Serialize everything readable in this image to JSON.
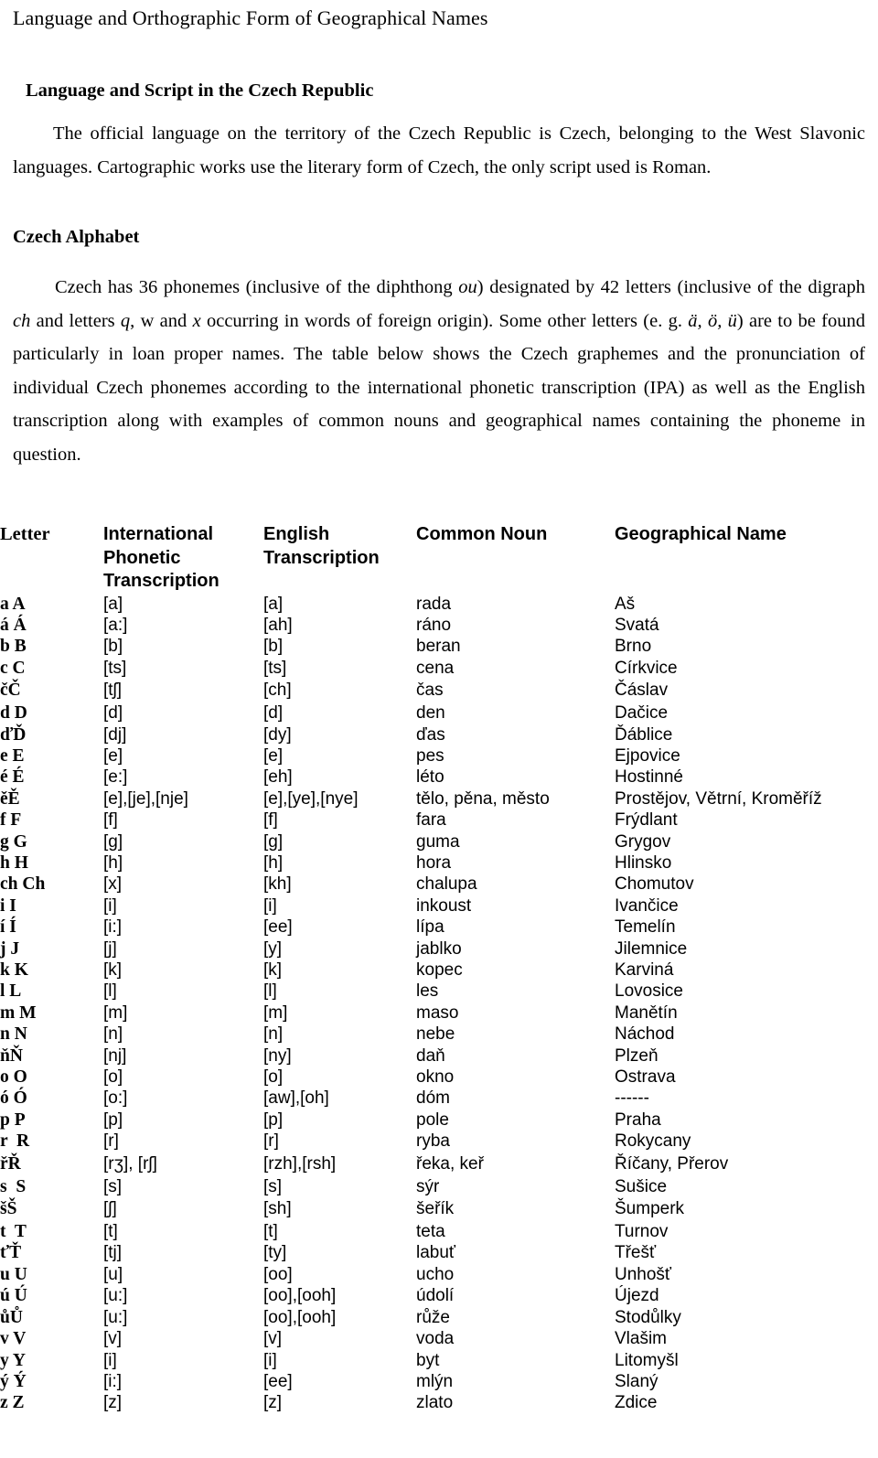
{
  "document": {
    "running_head": "Language and Orthographic Form of Geographical Names"
  },
  "sections": {
    "language_script": {
      "heading": "Language and Script in the Czech Republic",
      "paragraph_part1": "The official language on the territory of the Czech Republic is Czech, belonging to the West Slavonic languages. Cartographic works use the literary form of Czech, the only script used is Roman."
    },
    "czech_alphabet": {
      "heading": "Czech Alphabet",
      "p_a": "Czech has 36 phonemes (inclusive of the diphthong ",
      "p_a_i1": "ou",
      "p_b": ") designated by 42 letters (inclusive of the digraph ",
      "p_b_i": "ch",
      "p_c": " and letters ",
      "p_c_i": "q",
      "p_d": ", w and ",
      "p_d_i": "x",
      "p_e": " occurring in words of foreign origin). Some other letters (e. g. ",
      "p_e_i": "ä, ö, ü",
      "p_f": ") are to be found particularly in loan proper names. The table below shows the Czech graphemes and the pronunciation of individual Czech phonemes according to the international phonetic transcription (IPA) as well as the English transcription along with examples of common nouns and geographical names containing the phoneme in question."
    }
  },
  "table": {
    "headers": {
      "letter": "Letter",
      "ipa_line1": "International",
      "ipa_line2": "Phonetic",
      "ipa_line3": "Transcription",
      "english_line1": "English",
      "english_line2": "Transcription",
      "common_noun": "Common Noun",
      "geographical_name": "Geographical Name"
    },
    "rows": [
      {
        "letter": "a A",
        "ipa": "[a]",
        "english": "[a]",
        "noun": "rada",
        "geo": "Aš"
      },
      {
        "letter": "á Á",
        "ipa": "[a:]",
        "english": "[ah]",
        "noun": "ráno",
        "geo": "Svatá"
      },
      {
        "letter": "b B",
        "ipa": "[b]",
        "english": "[b]",
        "noun": "beran",
        "geo": "Brno"
      },
      {
        "letter": "c C",
        "ipa": "[ts]",
        "english": "[ts]",
        "noun": "cena",
        "geo": "Církvice"
      },
      {
        "letter": "čČ",
        "ipa": "[tʃ]",
        "english": "[ch]",
        "noun": "čas",
        "geo": "Čáslav",
        "tall": true
      },
      {
        "letter": "d D",
        "ipa": "[d]",
        "english": "[d]",
        "noun": "den",
        "geo": "Dačice"
      },
      {
        "letter": "ďĎ",
        "ipa": "[dj]",
        "english": "[dy]",
        "noun": "ďas",
        "geo": "Ďáblice"
      },
      {
        "letter": "e E",
        "ipa": "[e]",
        "english": "[e]",
        "noun": "pes",
        "geo": "Ejpovice"
      },
      {
        "letter": "é É",
        "ipa": "[e:]",
        "english": "[eh]",
        "noun": "léto",
        "geo": "Hostinné"
      },
      {
        "letter": "ěĚ",
        "ipa": "[e],[je],[nje]",
        "english": "[e],[ye],[nye]",
        "noun": "tělo, pěna, město",
        "geo": "Prostějov, Větrní, Kroměříž"
      },
      {
        "letter": "f F",
        "ipa": "[f]",
        "english": "[f]",
        "noun": "fara",
        "geo": "Frýdlant"
      },
      {
        "letter": "g G",
        "ipa": "[g]",
        "english": "[g]",
        "noun": "guma",
        "geo": "Grygov"
      },
      {
        "letter": "h H",
        "ipa": "[h]",
        "english": "[h]",
        "noun": "hora",
        "geo": "Hlinsko"
      },
      {
        "letter": "ch Ch",
        "ipa": "[x]",
        "english": "[kh]",
        "noun": "chalupa",
        "geo": "Chomutov"
      },
      {
        "letter": "i I",
        "ipa": "[i]",
        "english": "[i]",
        "noun": "inkoust",
        "geo": "Ivančice"
      },
      {
        "letter": "í Í",
        "ipa": "[i:]",
        "english": "[ee]",
        "noun": "lípa",
        "geo": "Temelín"
      },
      {
        "letter": "j J",
        "ipa": "[j]",
        "english": "[y]",
        "noun": "jablko",
        "geo": "Jilemnice"
      },
      {
        "letter": "k K",
        "ipa": "[k]",
        "english": "[k]",
        "noun": "kopec",
        "geo": "Karviná"
      },
      {
        "letter": "l L",
        "ipa": "[l]",
        "english": "[l]",
        "noun": "les",
        "geo": "Lovosice"
      },
      {
        "letter": "m M",
        "ipa": "[m]",
        "english": "[m]",
        "noun": "maso",
        "geo": "Manětín"
      },
      {
        "letter": "n N",
        "ipa": "[n]",
        "english": "[n]",
        "noun": "nebe",
        "geo": "Náchod"
      },
      {
        "letter": "ňŇ",
        "ipa": "[nj]",
        "english": "[ny]",
        "noun": "daň",
        "geo": "Plzeň"
      },
      {
        "letter": "o O",
        "ipa": "[o]",
        "english": "[o]",
        "noun": "okno",
        "geo": "Ostrava"
      },
      {
        "letter": "ó Ó",
        "ipa": "[o:]",
        "english": "[aw],[oh]",
        "noun": "dóm",
        "geo": "------"
      },
      {
        "letter": "p P",
        "ipa": "[p]",
        "english": "[p]",
        "noun": "pole",
        "geo": "Praha"
      },
      {
        "letter": "r  R",
        "ipa": "[r]",
        "english": "[r]",
        "noun": "ryba",
        "geo": "Rokycany"
      },
      {
        "letter": "řŘ",
        "ipa": "[rʒ], [rʃ]",
        "english": "[rzh],[rsh]",
        "noun": "řeka, keř",
        "geo": "Říčany, Přerov",
        "tall": true
      },
      {
        "letter": "s  S",
        "ipa": "[s]",
        "english": "[s]",
        "noun": "sýr",
        "geo": "Sušice"
      },
      {
        "letter": "šŠ",
        "ipa": "[ʃ]",
        "english": "[sh]",
        "noun": "šeřík",
        "geo": "Šumperk",
        "tall": true
      },
      {
        "letter": "t  T",
        "ipa": "[t]",
        "english": "[t]",
        "noun": "teta",
        "geo": "Turnov"
      },
      {
        "letter": "ťŤ",
        "ipa": "[tj]",
        "english": "[ty]",
        "noun": "labuť",
        "geo": "Třešť"
      },
      {
        "letter": "u U",
        "ipa": "[u]",
        "english": "[oo]",
        "noun": "ucho",
        "geo": "Unhošť"
      },
      {
        "letter": "ú Ú",
        "ipa": "[u:]",
        "english": "[oo],[ooh]",
        "noun": "údolí",
        "geo": "Újezd"
      },
      {
        "letter": "ůŮ",
        "ipa": "[u:]",
        "english": "[oo],[ooh]",
        "noun": "růže",
        "geo": "Stodůlky"
      },
      {
        "letter": "v V",
        "ipa": "[v]",
        "english": "[v]",
        "noun": "voda",
        "geo": "Vlašim"
      },
      {
        "letter": "y Y",
        "ipa": "[i]",
        "english": "[i]",
        "noun": "byt",
        "geo": "Litomyšl"
      },
      {
        "letter": "ý Ý",
        "ipa": "[i:]",
        "english": "[ee]",
        "noun": "mlýn",
        "geo": "Slaný"
      },
      {
        "letter": "z Z",
        "ipa": "[z]",
        "english": "[z]",
        "noun": "zlato",
        "geo": "Zdice"
      }
    ]
  }
}
